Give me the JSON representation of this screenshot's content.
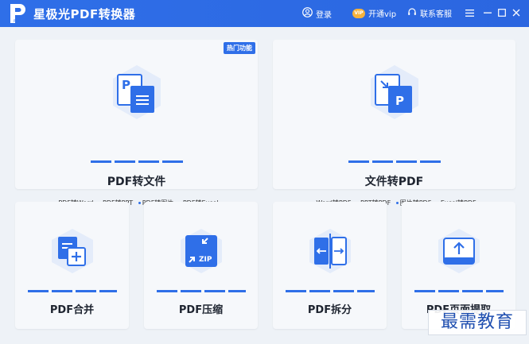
{
  "titlebar": {
    "app_title": "星极光PDF转换器",
    "login_label": "登录",
    "vip_badge": "VIP",
    "vip_label": "开通vip",
    "service_label": "联系客服",
    "logo_sub": "PDF"
  },
  "cards": {
    "pdf_to_file": {
      "title": "PDF转文件",
      "hot_tag": "热门功能",
      "features": [
        "PDF转Word",
        "PDF转PPT",
        "PDF转图片",
        "PDF转Excel"
      ]
    },
    "file_to_pdf": {
      "title": "文件转PDF",
      "features": [
        "Word转PDF",
        "PPT转PDF",
        "图片转PDF",
        "Excel转PDF"
      ]
    },
    "merge": {
      "title": "PDF合并"
    },
    "compress": {
      "title": "PDF压缩",
      "icon_text": "ZIP"
    },
    "split": {
      "title": "PDF拆分"
    },
    "extract": {
      "title": "PDF页面提取"
    }
  },
  "icon_labels": {
    "pdf_letter": "P"
  },
  "watermark": "最需教育",
  "colors": {
    "accent": "#2f6fe8",
    "dot_red": "#e6463c",
    "dot_orange": "#f4a62a",
    "dot_blue": "#2f6fe8",
    "dot_green": "#3cc18b"
  },
  "icons": {
    "logo": "pdf-logo-icon",
    "login": "user-circle-icon",
    "service": "headset-icon",
    "menu": "menu-icon",
    "minimize": "minimize-icon",
    "maximize": "maximize-icon",
    "close": "close-icon"
  }
}
